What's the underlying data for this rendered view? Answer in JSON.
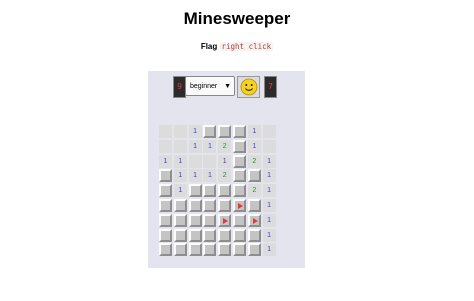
{
  "title": "Minesweeper",
  "hint": {
    "label": "Flag",
    "code": "right click"
  },
  "controls": {
    "mines_left": "9",
    "difficulty": "beginner",
    "timer": "7",
    "face": "smiley-icon"
  },
  "colors": {
    "n1": "#3c3cdc",
    "n2": "#2e8b2e",
    "flag": "#e53935",
    "counter": "#e53935"
  },
  "board": {
    "legend": "R=revealed empty, H=hidden, F=flagged, digit=revealed number",
    "rows": [
      [
        "R",
        "R",
        "1",
        "H",
        "H",
        "H",
        "1",
        "R"
      ],
      [
        "R",
        "R",
        "1",
        "1",
        "2",
        "H",
        "1",
        "R"
      ],
      [
        "1",
        "1",
        "R",
        "R",
        "1",
        "H",
        "2",
        "1"
      ],
      [
        "H",
        "1",
        "1",
        "1",
        "2",
        "H",
        "H",
        "1"
      ],
      [
        "H",
        "1",
        "H",
        "H",
        "H",
        "H",
        "2",
        "1"
      ],
      [
        "H",
        "H",
        "H",
        "H",
        "H",
        "F",
        "H",
        "1"
      ],
      [
        "H",
        "H",
        "H",
        "H",
        "F",
        "H",
        "F",
        "1"
      ],
      [
        "H",
        "H",
        "H",
        "H",
        "H",
        "H",
        "H",
        "1"
      ],
      [
        "H",
        "H",
        "H",
        "H",
        "H",
        "H",
        "H",
        "1"
      ]
    ]
  }
}
